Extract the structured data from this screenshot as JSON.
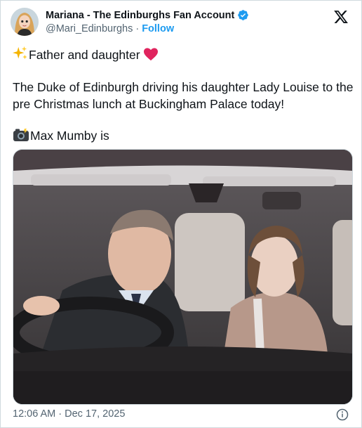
{
  "author": {
    "display_name": "Mariana - The Edinburghs Fan Account",
    "handle": "@Mari_Edinburghs",
    "separator": "·",
    "follow_label": "Follow"
  },
  "tweet": {
    "line1": "Father and daughter",
    "line2": "The Duke of Edinburgh driving his daughter Lady Louise to the pre Christmas lunch at Buckingham Palace today!",
    "line3": "Max Mumby is"
  },
  "icons": {
    "verified": "verified-badge-icon",
    "x_logo": "x-logo-icon",
    "sparkles": "sparkles-emoji-icon",
    "heart": "red-heart-emoji-icon",
    "camera": "camera-flash-emoji-icon",
    "info": "info-icon"
  },
  "colors": {
    "accent": "#1d9bf0",
    "text": "#0f1419",
    "secondary": "#536471",
    "heart": "#e0245e"
  },
  "timestamp": "12:06 AM · Dec 17, 2025"
}
